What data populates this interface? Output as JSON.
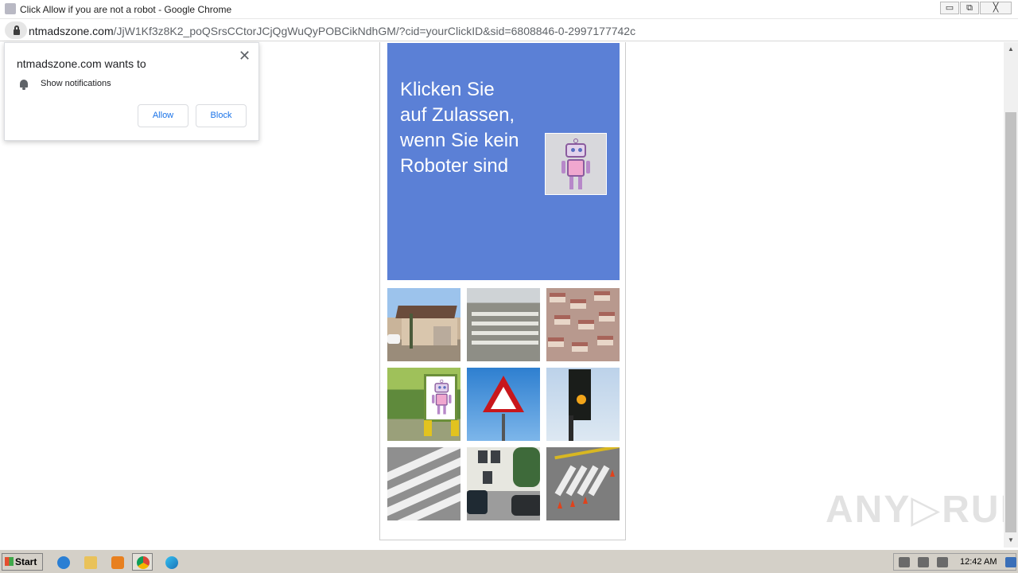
{
  "window": {
    "title": "Click Allow if you are not a robot - Google Chrome",
    "min_glyph": "▭",
    "max_glyph": "⧉",
    "close_glyph": "╳"
  },
  "address": {
    "domain": "ntmadszone.com",
    "path": "/JjW1Kf3z8K2_poQSrsCCtorJCjQgWuQyPOBCikNdhGM/?cid=yourClickID&sid=6808846-0-2997177742c"
  },
  "notification": {
    "heading": "ntmadszone.com wants to",
    "permission": "Show notifications",
    "allow_label": "Allow",
    "block_label": "Block",
    "close_glyph": "✕"
  },
  "captcha": {
    "banner_text": "Klicken Sie auf Zulassen, wenn Sie kein Roboter sind",
    "banner_color": "#5b80d6",
    "tiles": [
      "house",
      "crosswalk-gravel",
      "houses-aerial",
      "robot-sign",
      "pedestrian-sign",
      "traffic-light",
      "zebra-crossing",
      "street-cars",
      "crosswalk-cones"
    ]
  },
  "scrollbar": {
    "up_glyph": "▲",
    "down_glyph": "▼"
  },
  "watermark": "ANY▷RUN",
  "taskbar": {
    "start_label": "Start",
    "clock": "12:42 AM",
    "icons": [
      "internet-explorer-icon",
      "folder-icon",
      "media-player-icon",
      "chrome-icon",
      "edge-icon"
    ]
  }
}
